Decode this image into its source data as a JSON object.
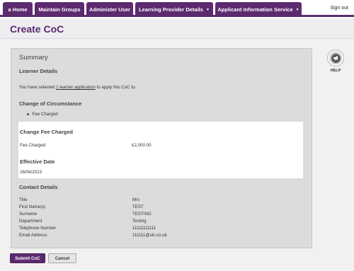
{
  "nav": {
    "tabs": [
      {
        "label": "a Home",
        "dropdown": false
      },
      {
        "label": "Maintain Groups",
        "dropdown": false
      },
      {
        "label": "Administer User",
        "dropdown": false
      },
      {
        "label": "Learning Provider Details",
        "dropdown": true
      },
      {
        "label": "Applicant Information Service",
        "dropdown": true
      }
    ],
    "caret": "▼",
    "sign_out": "Sign out"
  },
  "page_title": "Create CoC",
  "summary": {
    "title": "Summary",
    "learner_heading": "Learner Details",
    "learner_text_before": "You have selected ",
    "learner_link": "1 learner application",
    "learner_text_after": " to apply this CoC to.",
    "coc_heading": "Change of Circumstance",
    "coc_items": [
      "Fee Charged"
    ],
    "change_heading": "Change Fee Charged",
    "fee_label": "Fee Charged",
    "fee_value": "£2,000.00",
    "effective_heading": "Effective Date",
    "effective_value": "26/04/2023",
    "contact_heading": "Contact Details",
    "contact_rows": [
      {
        "label": "Title",
        "value": "Mrs"
      },
      {
        "label": "First Name(s)",
        "value": "TEST"
      },
      {
        "label": "Surname",
        "value": "TESTING"
      },
      {
        "label": "Department",
        "value": "Testing"
      },
      {
        "label": "Telephone Number",
        "value": "11111111111"
      },
      {
        "label": "Email Address",
        "value": "111111@slc.co.uk"
      }
    ]
  },
  "help": {
    "label": "HELP",
    "icon": "megaphone-icon"
  },
  "buttons": {
    "submit": "Submit CoC",
    "cancel": "Cancel"
  },
  "colors": {
    "brand": "#5c2a6e",
    "panel": "#dcdcdc",
    "background": "#f1f1f1"
  }
}
